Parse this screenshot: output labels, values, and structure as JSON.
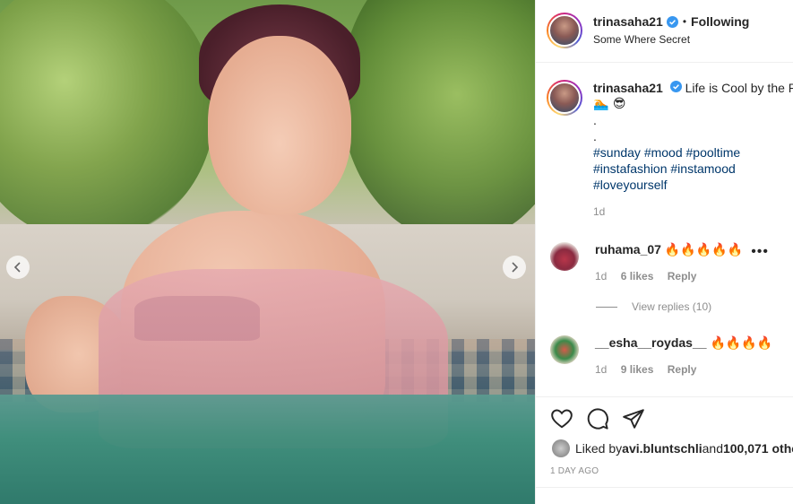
{
  "post": {
    "username": "trinasaha21",
    "follow_status": "Following",
    "location": "Some Where Secret"
  },
  "caption": {
    "username": "trinasaha21",
    "text": "Life is Cool by the Po",
    "emoji_line": "🏊 😎",
    "dot1": ".",
    "dot2": ".",
    "hashtags_line1": "#sunday #mood #pooltime",
    "hashtags_line2": "#instafashion #instamood",
    "hashtags_line3": "#loveyourself",
    "time": "1d"
  },
  "comments": [
    {
      "username": "ruhama_07",
      "text": "🔥🔥🔥🔥🔥",
      "time": "1d",
      "likes": "6 likes",
      "reply": "Reply"
    },
    {
      "username": "__esha__roydas__",
      "text": "🔥🔥🔥🔥",
      "time": "1d",
      "likes": "9 likes",
      "reply": "Reply"
    }
  ],
  "view_replies": "View replies (10)",
  "likes_summary": {
    "prefix": "Liked by ",
    "user": "avi.bluntschli",
    "middle": " and ",
    "count": "100,071 othe"
  },
  "post_time": "1 DAY AGO",
  "icons": {
    "heart": "heart-icon",
    "comment": "comment-icon",
    "share": "share-icon",
    "more": "more-icon",
    "prev": "chevron-left-icon",
    "next": "chevron-right-icon",
    "verified": "verified-icon"
  },
  "colors": {
    "link": "#00376b",
    "muted": "#8e8e8e",
    "text": "#262626",
    "verified": "#3897f0"
  }
}
